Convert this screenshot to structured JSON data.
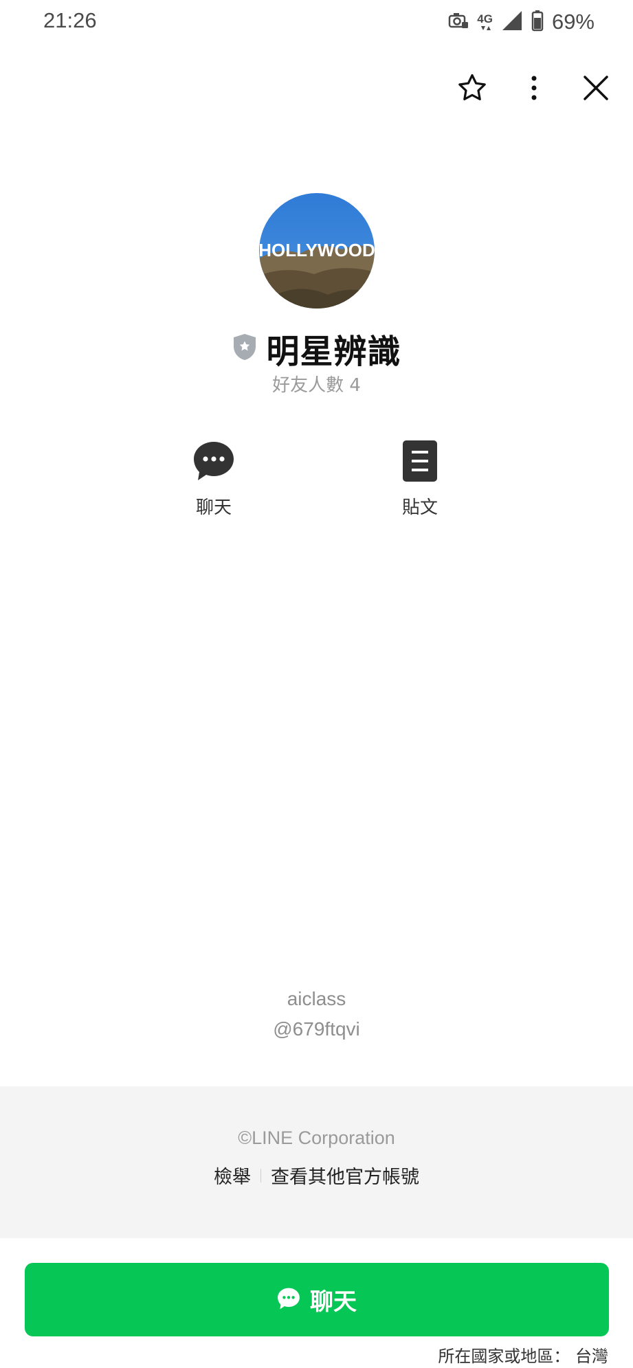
{
  "status_bar": {
    "time": "21:26",
    "network": "4G",
    "battery": "69%",
    "icons": [
      "camera-lock-icon",
      "network-4g-icon",
      "signal-icon",
      "battery-icon"
    ]
  },
  "header_actions": {
    "icons": [
      "star-icon",
      "more-vertical-icon",
      "close-icon"
    ]
  },
  "profile": {
    "avatar_text": "HOLLYWOOD",
    "title": "明星辨識",
    "badge_icon": "official-shield-icon",
    "friends": "好友人數 4"
  },
  "actions": [
    {
      "label": "聊天",
      "icon": "chat-bubble-icon"
    },
    {
      "label": "貼文",
      "icon": "post-document-icon"
    }
  ],
  "account": {
    "name": "aiclass",
    "id": "@679ftqvi"
  },
  "footer": {
    "copyright": "©LINE Corporation",
    "report": "檢舉",
    "other_accounts": "查看其他官方帳號"
  },
  "bottom": {
    "chat_label": "聊天",
    "region": "所在國家或地區： 台灣"
  },
  "colors": {
    "brand_green": "#06c755",
    "footer_bg": "#f4f4f4",
    "icon_dark": "#333333"
  }
}
